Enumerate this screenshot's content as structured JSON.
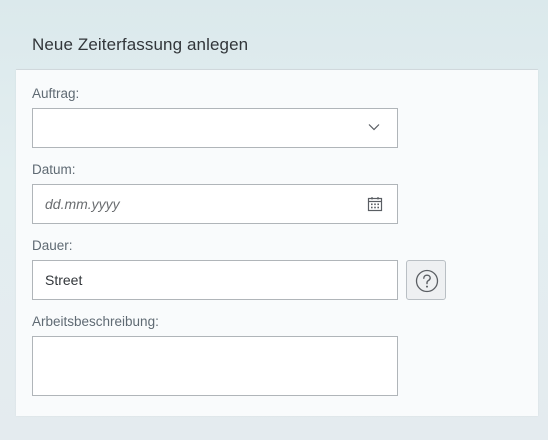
{
  "dialog": {
    "title": "Neue Zeiterfassung anlegen"
  },
  "form": {
    "auftrag": {
      "label": "Auftrag:",
      "value": "",
      "icon": "chevron-down-icon"
    },
    "datum": {
      "label": "Datum:",
      "placeholder": "dd.mm.yyyy",
      "icon": "calendar-icon"
    },
    "dauer": {
      "label": "Dauer:",
      "value": "Street",
      "help_icon": "help-circle-icon"
    },
    "arbeitsbeschreibung": {
      "label": "Arbeitsbeschreibung:",
      "value": ""
    }
  },
  "colors": {
    "title_text": "#32363a",
    "label_text": "#5f6a73",
    "border": "#b0b5b9",
    "panel_bg": "#f9fbfc",
    "page_bg": "#dbe9ec"
  }
}
